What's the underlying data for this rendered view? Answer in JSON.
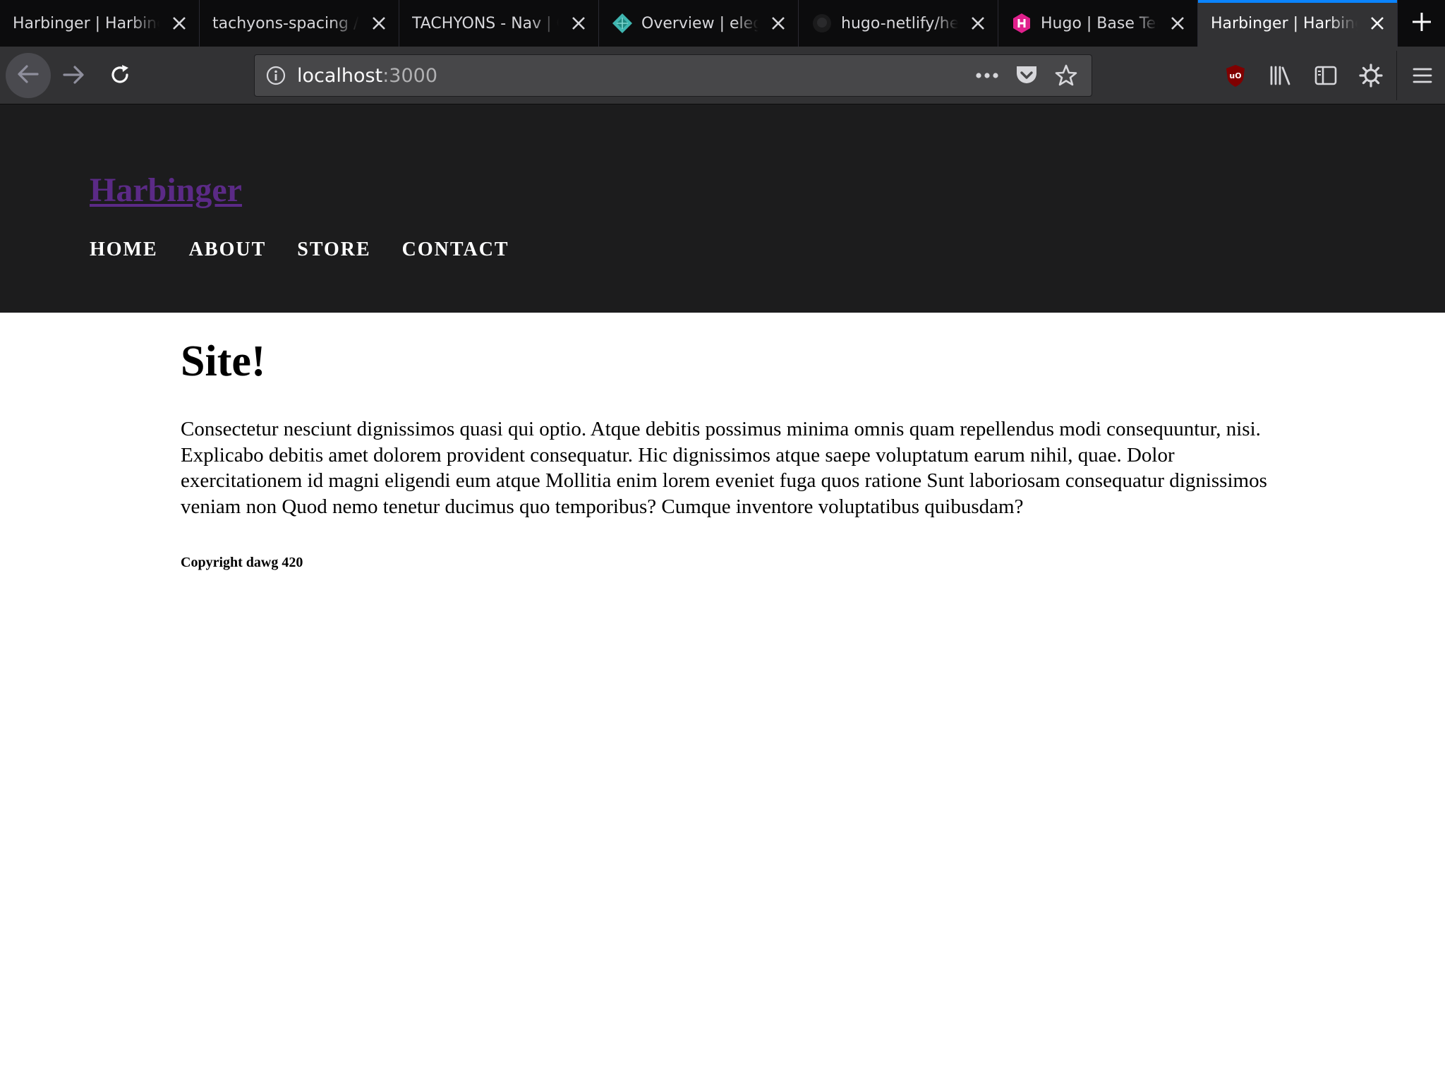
{
  "browser": {
    "tabs": [
      {
        "title": "Harbinger | Harbinger",
        "favicon": "none"
      },
      {
        "title": "tachyons-spacing / TACHYONS",
        "favicon": "none"
      },
      {
        "title": "TACHYONS - Nav | Components",
        "favicon": "none"
      },
      {
        "title": "Overview | elegant",
        "favicon": "netlify-icon"
      },
      {
        "title": "hugo-netlify/hello",
        "favicon": "github-icon"
      },
      {
        "title": "Hugo | Base Templates",
        "favicon": "hugo-icon"
      },
      {
        "title": "Harbinger | Harbinger",
        "favicon": "none",
        "active": true
      }
    ],
    "url": {
      "host": "localhost",
      "port": ":3000"
    },
    "colors": {
      "accent": "#0a84ff",
      "tabbar": "#0c0c0d",
      "toolbar": "#323234"
    }
  },
  "site": {
    "logo": "Harbinger",
    "nav": [
      "HOME",
      "ABOUT",
      "STORE",
      "CONTACT"
    ],
    "title": "Site!",
    "body": "Consectetur nesciunt dignissimos quasi qui optio. Atque debitis possimus minima omnis quam repellendus modi consequuntur, nisi. Explicabo debitis amet dolorem provident consequatur. Hic dignissimos atque saepe voluptatum earum nihil, quae. Dolor exercitationem id magni eligendi eum atque Mollitia enim lorem eveniet fuga quos ratione Sunt laboriosam consequatur dignissimos veniam non Quod nemo tenetur ducimus quo temporibus? Cumque inventore voluptatibus quibusdam?",
    "footer": "Copyright dawg 420",
    "colors": {
      "header_bg": "#1c1c1d",
      "logo": "#5b2a86"
    }
  }
}
